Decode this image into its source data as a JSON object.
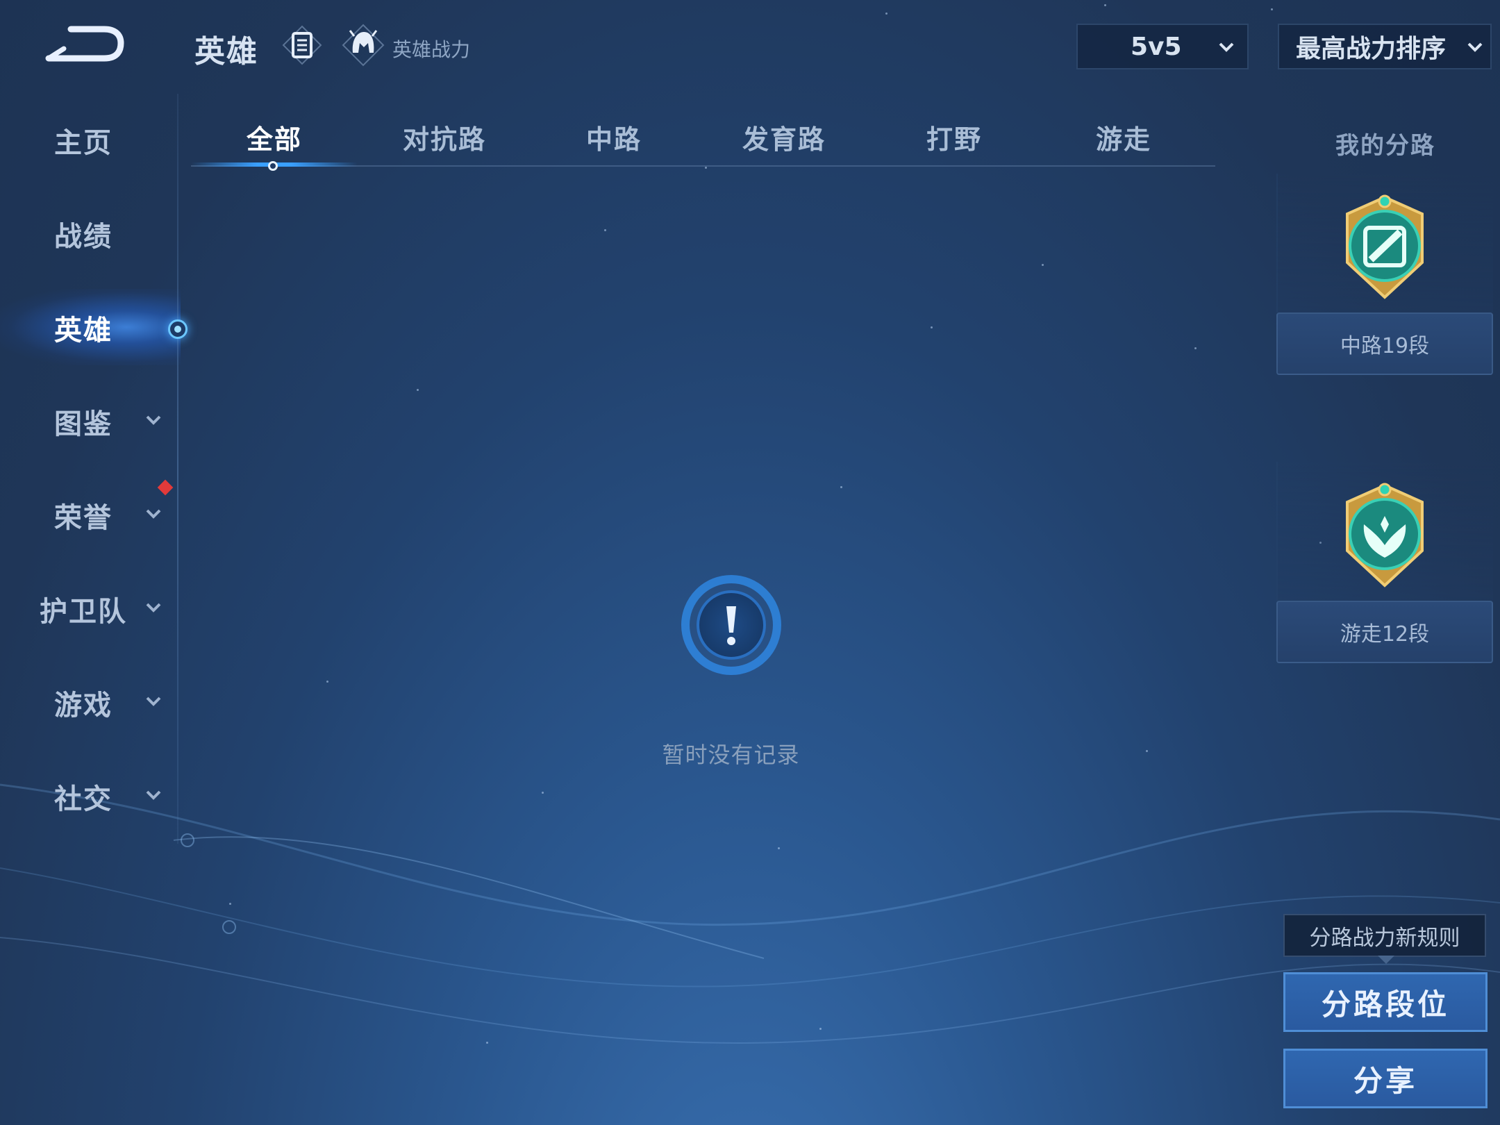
{
  "header": {
    "title": "英雄",
    "hero_power_label": "英雄战力",
    "mode_value": "5v5",
    "sort_value": "最高战力排序"
  },
  "sidebar": {
    "items": [
      {
        "label": "主页",
        "has_chevron": false
      },
      {
        "label": "战绩",
        "has_chevron": false
      },
      {
        "label": "英雄",
        "has_chevron": false,
        "active": true
      },
      {
        "label": "图鉴",
        "has_chevron": true
      },
      {
        "label": "荣誉",
        "has_chevron": true,
        "badge": true
      },
      {
        "label": "护卫队",
        "has_chevron": true
      },
      {
        "label": "游戏",
        "has_chevron": true
      },
      {
        "label": "社交",
        "has_chevron": true
      }
    ]
  },
  "tabs": [
    {
      "label": "全部",
      "active": true
    },
    {
      "label": "对抗路"
    },
    {
      "label": "中路"
    },
    {
      "label": "发育路"
    },
    {
      "label": "打野"
    },
    {
      "label": "游走"
    }
  ],
  "empty_state": {
    "message": "暂时没有记录",
    "icon": "exclamation-icon"
  },
  "lanes": {
    "title": "我的分路",
    "cards": [
      {
        "label": "中路19段",
        "icon": "mid-lane-badge-icon"
      },
      {
        "label": "游走12段",
        "icon": "roam-lane-badge-icon"
      }
    ]
  },
  "actions": {
    "rule_label": "分路战力新规则",
    "lane_rank_label": "分路段位",
    "share_label": "分享"
  },
  "colors": {
    "background": "#22426e",
    "accent": "#3aa0ff",
    "button": "#2f67b0",
    "badge_red": "#e23a3a"
  }
}
